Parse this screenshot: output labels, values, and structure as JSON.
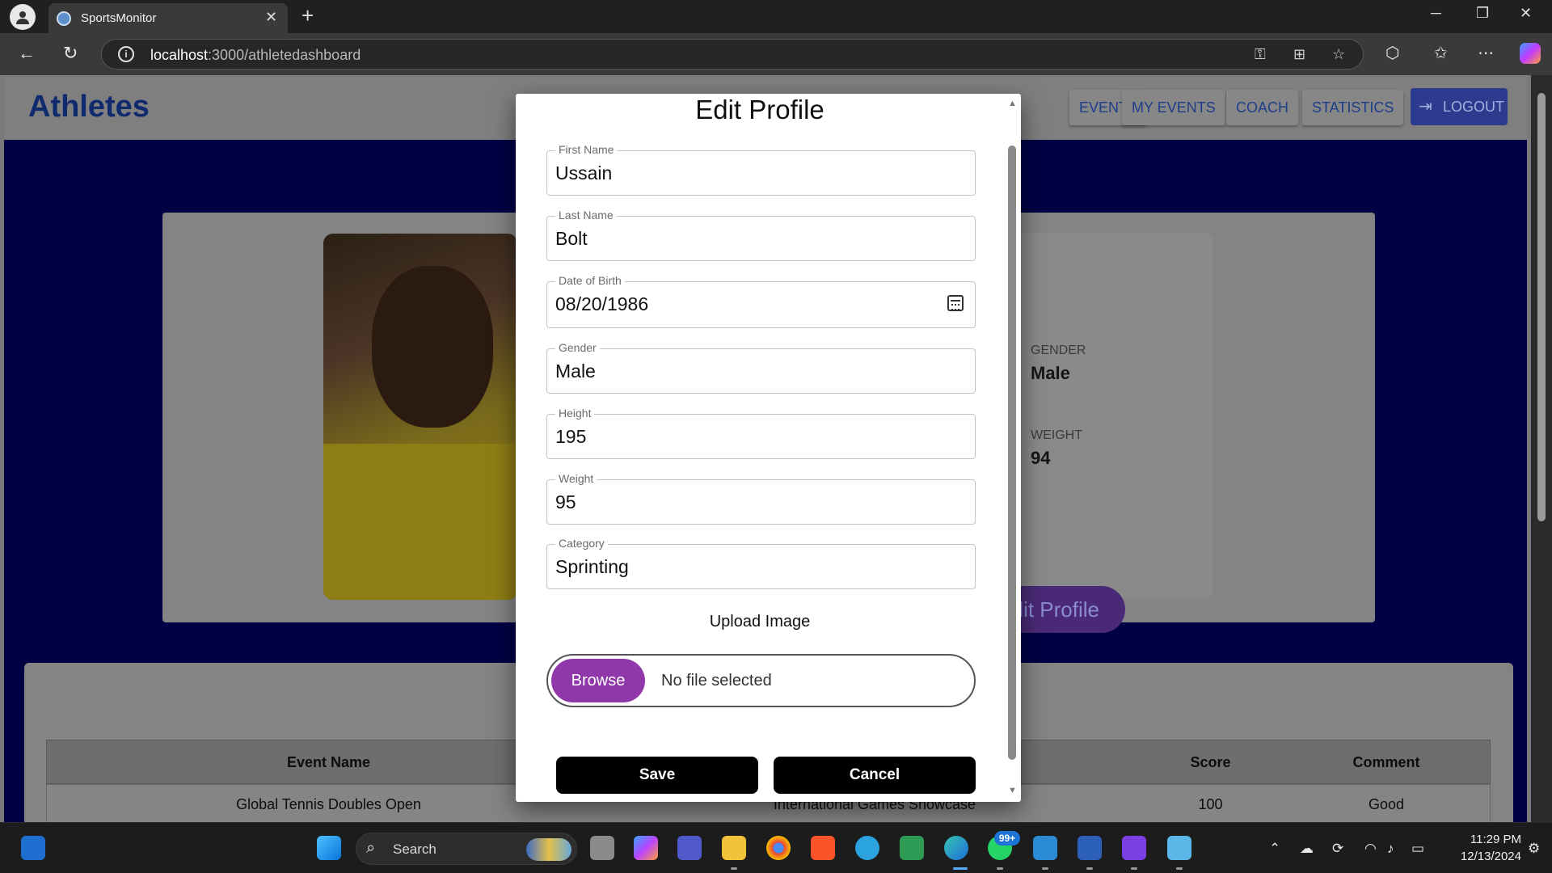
{
  "browser": {
    "tab_title": "SportsMonitor",
    "url_host": "localhost",
    "url_path": ":3000/athletedashboard"
  },
  "app": {
    "title": "Athletes",
    "nav": [
      "EVENTS",
      "MY EVENTS",
      "COACH",
      "STATISTICS"
    ],
    "logout_label": "LOGOUT"
  },
  "profile": {
    "gender_label": "GENDER",
    "gender_value": "Male",
    "weight_label": "WEIGHT",
    "weight_value": "94",
    "edit_button": "lit Profile"
  },
  "table": {
    "headers": [
      "Event Name",
      "Score",
      "Comment"
    ],
    "rows": [
      {
        "event_name": "Global Tennis Doubles Open",
        "other": "International Games Showcase",
        "score": "100",
        "comment": "Good"
      }
    ]
  },
  "modal": {
    "title": "Edit Profile",
    "fields": [
      {
        "label": "First Name",
        "value": "Ussain"
      },
      {
        "label": "Last Name",
        "value": "Bolt"
      },
      {
        "label": "Date of Birth",
        "value": "08/20/1986"
      },
      {
        "label": "Gender",
        "value": "Male"
      },
      {
        "label": "Height",
        "value": "195"
      },
      {
        "label": "Weight",
        "value": "95"
      },
      {
        "label": "Category",
        "value": "Sprinting"
      }
    ],
    "upload_label": "Upload Image",
    "browse_label": "Browse",
    "file_status": "No file selected",
    "save_label": "Save",
    "cancel_label": "Cancel"
  },
  "taskbar": {
    "search_label": "Search",
    "whatsapp_badge": "99+",
    "time": "11:29 PM",
    "date": "12/13/2024"
  },
  "icons": {
    "browser": [
      "profile-icon",
      "favicon-icon",
      "close-tab-icon",
      "new-tab-icon",
      "minimize-icon",
      "restore-icon",
      "close-window-icon",
      "back-icon",
      "refresh-icon",
      "info-icon",
      "key-icon",
      "apps-icon",
      "star-icon",
      "extensions-icon",
      "favorites-icon",
      "more-icon",
      "copilot-icon"
    ],
    "modal": [
      "calendar-icon"
    ],
    "app": [
      "logout-icon"
    ]
  },
  "colors": {
    "brand_title": "#102a6e",
    "browse_purple": "#9038a9",
    "page_blue": "#000045"
  }
}
